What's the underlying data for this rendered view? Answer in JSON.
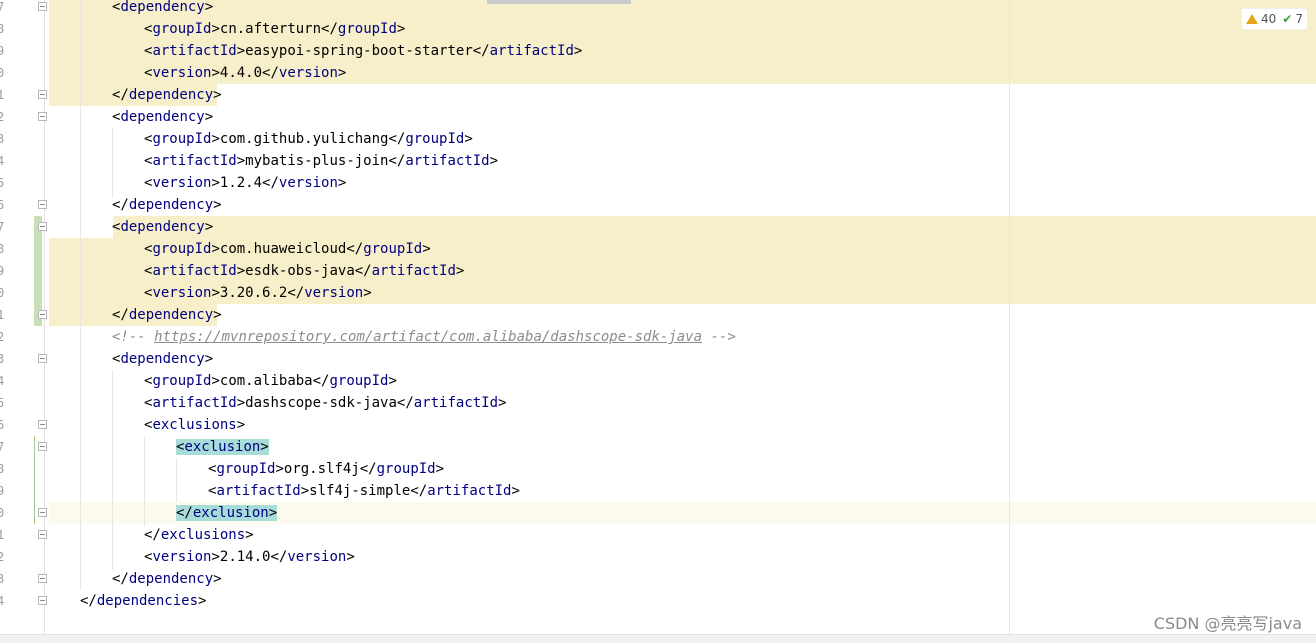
{
  "inspection": {
    "warnings": "40",
    "checks": "7"
  },
  "watermark": "CSDN @亮亮写java",
  "lines": [
    {
      "ln": "7",
      "tag_open": "dependency",
      "text": "",
      "tag_close": ""
    },
    {
      "ln": "8",
      "tag_open": "groupId",
      "text": "cn.afterturn",
      "tag_close": "groupId"
    },
    {
      "ln": "9",
      "tag_open": "artifactId",
      "text": "easypoi-spring-boot-starter",
      "tag_close": "artifactId"
    },
    {
      "ln": "0",
      "tag_open": "version",
      "text": "4.4.0",
      "tag_close": "version"
    },
    {
      "ln": "1",
      "tag_open": "",
      "text": "",
      "tag_close": "dependency"
    },
    {
      "ln": "2",
      "tag_open": "dependency",
      "text": "",
      "tag_close": ""
    },
    {
      "ln": "3",
      "tag_open": "groupId",
      "text": "com.github.yulichang",
      "tag_close": "groupId"
    },
    {
      "ln": "4",
      "tag_open": "artifactId",
      "text": "mybatis-plus-join",
      "tag_close": "artifactId"
    },
    {
      "ln": "5",
      "tag_open": "version",
      "text": "1.2.4",
      "tag_close": "version"
    },
    {
      "ln": "6",
      "tag_open": "",
      "text": "",
      "tag_close": "dependency"
    },
    {
      "ln": "7",
      "tag_open": "dependency",
      "text": "",
      "tag_close": ""
    },
    {
      "ln": "8",
      "tag_open": "groupId",
      "text": "com.huaweicloud",
      "tag_close": "groupId"
    },
    {
      "ln": "9",
      "tag_open": "artifactId",
      "text": "esdk-obs-java",
      "tag_close": "artifactId"
    },
    {
      "ln": "0",
      "tag_open": "version",
      "text": "3.20.6.2",
      "tag_close": "version"
    },
    {
      "ln": "1",
      "tag_open": "",
      "text": "",
      "tag_close": "dependency"
    },
    {
      "ln": "2",
      "comment_start": "<!-- ",
      "comment_url": "https://mvnrepository.com/artifact/com.alibaba/dashscope-sdk-java",
      "comment_end": " -->"
    },
    {
      "ln": "3",
      "tag_open": "dependency",
      "text": "",
      "tag_close": ""
    },
    {
      "ln": "4",
      "tag_open": "groupId",
      "text": "com.alibaba",
      "tag_close": "groupId"
    },
    {
      "ln": "5",
      "tag_open": "artifactId",
      "text": "dashscope-sdk-java",
      "tag_close": "artifactId"
    },
    {
      "ln": "6",
      "tag_open": "exclusions",
      "text": "",
      "tag_close": ""
    },
    {
      "ln": "7",
      "tag_open": "exclusion",
      "text": "",
      "tag_close": ""
    },
    {
      "ln": "8",
      "tag_open": "groupId",
      "text": "org.slf4j",
      "tag_close": "groupId"
    },
    {
      "ln": "9",
      "tag_open": "artifactId",
      "text": "slf4j-simple",
      "tag_close": "artifactId"
    },
    {
      "ln": "0",
      "tag_open": "",
      "text": "",
      "tag_close": "exclusion"
    },
    {
      "ln": "1",
      "tag_open": "",
      "text": "",
      "tag_close": "exclusions"
    },
    {
      "ln": "2",
      "tag_open": "version",
      "text": "2.14.0",
      "tag_close": "version"
    },
    {
      "ln": "3",
      "tag_open": "",
      "text": "",
      "tag_close": "dependency"
    },
    {
      "ln": "4",
      "tag_open": "",
      "text": "",
      "tag_close": "dependencies"
    }
  ]
}
